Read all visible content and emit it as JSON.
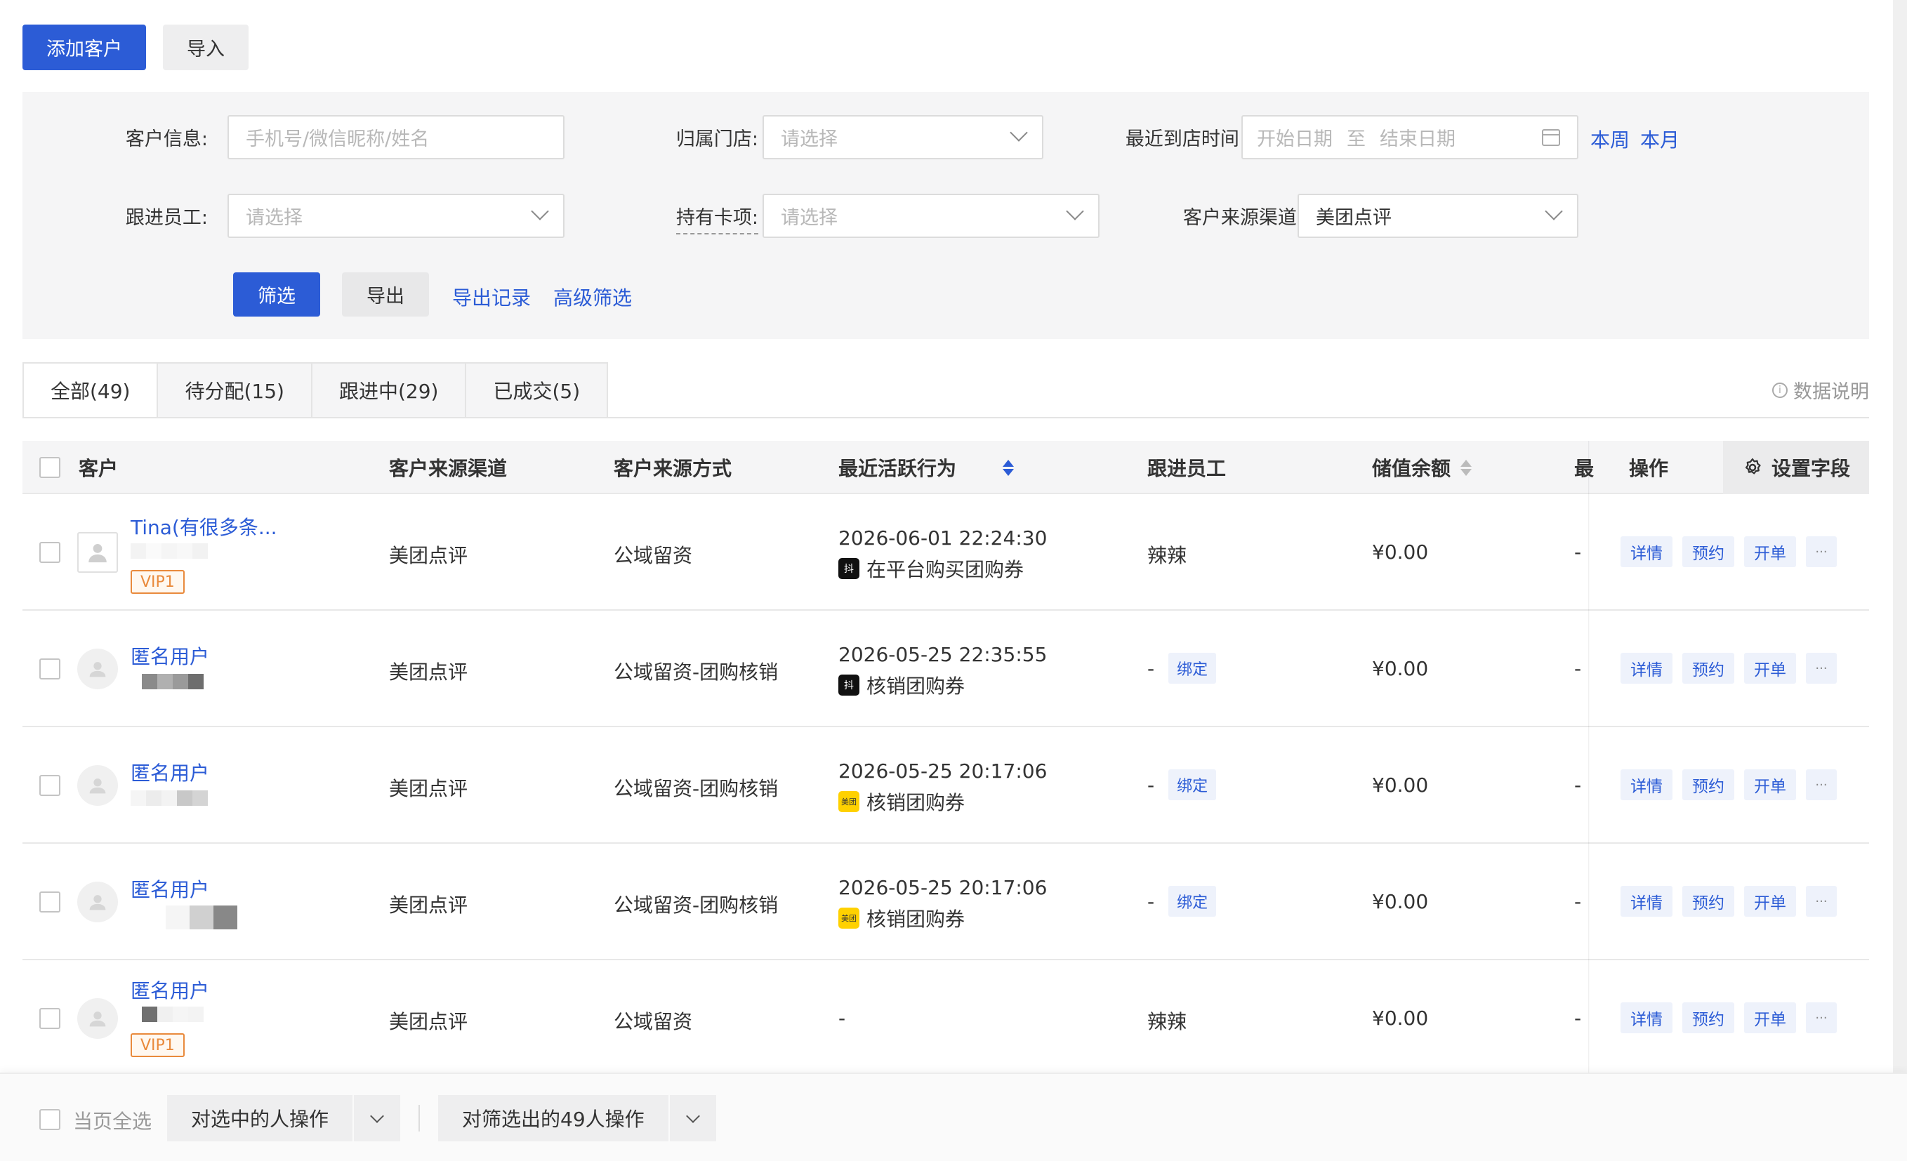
{
  "toolbar": {
    "add_customer": "添加客户",
    "import": "导入"
  },
  "filters": {
    "customer_info": {
      "label": "客户信息:",
      "placeholder": "手机号/微信昵称/姓名"
    },
    "store": {
      "label": "归属门店:",
      "placeholder": "请选择"
    },
    "last_visit": {
      "label": "最近到店时间:",
      "start": "开始日期",
      "sep": "至",
      "end": "结束日期",
      "this_week": "本周",
      "this_month": "本月"
    },
    "staff": {
      "label": "跟进员工:",
      "placeholder": "请选择"
    },
    "card": {
      "label": "持有卡项:",
      "placeholder": "请选择"
    },
    "channel": {
      "label": "客户来源渠道:",
      "value": "美团点评"
    },
    "filter_btn": "筛选",
    "export_btn": "导出",
    "export_records": "导出记录",
    "advanced_filter": "高级筛选"
  },
  "tabs": [
    {
      "label": "全部(49)"
    },
    {
      "label": "待分配(15)"
    },
    {
      "label": "跟进中(29)"
    },
    {
      "label": "已成交(5)"
    }
  ],
  "data_note": "数据说明",
  "table": {
    "headers": {
      "customer": "客户",
      "channel": "客户来源渠道",
      "method": "客户来源方式",
      "activity": "最近活跃行为",
      "staff": "跟进员工",
      "balance": "储值余额",
      "last": "最",
      "ops": "操作",
      "settings": "设置字段"
    },
    "op_labels": {
      "detail": "详情",
      "book": "预约",
      "order": "开单",
      "more": "···"
    },
    "bind_label": "绑定",
    "rows": [
      {
        "name": "Tina(有很多条...",
        "vip": "VIP1",
        "channel": "美团点评",
        "method": "公域留资",
        "time": "2026-06-01 22:24:30",
        "platform": "tiktok",
        "desc": "在平台购买团购券",
        "staff": "辣辣",
        "balance": "¥0.00",
        "last": "-"
      },
      {
        "name": "匿名用户",
        "vip": "",
        "channel": "美团点评",
        "method": "公域留资-团购核销",
        "time": "2026-05-25 22:35:55",
        "platform": "tiktok",
        "desc": "核销团购券",
        "staff": "-",
        "balance": "¥0.00",
        "last": "-"
      },
      {
        "name": "匿名用户",
        "vip": "",
        "channel": "美团点评",
        "method": "公域留资-团购核销",
        "time": "2026-05-25 20:17:06",
        "platform": "meituan",
        "desc": "核销团购券",
        "staff": "-",
        "balance": "¥0.00",
        "last": "-"
      },
      {
        "name": "匿名用户",
        "vip": "",
        "channel": "美团点评",
        "method": "公域留资-团购核销",
        "time": "2026-05-25 20:17:06",
        "platform": "meituan",
        "desc": "核销团购券",
        "staff": "-",
        "balance": "¥0.00",
        "last": "-"
      },
      {
        "name": "匿名用户",
        "vip": "VIP1",
        "channel": "美团点评",
        "method": "公域留资",
        "time": "",
        "platform": "",
        "desc": "-",
        "staff": "辣辣",
        "balance": "¥0.00",
        "last": "-"
      }
    ]
  },
  "bottom": {
    "select_page": "当页全选",
    "op_selected": "对选中的人操作",
    "op_filtered": "对筛选出的49人操作"
  },
  "colors": {
    "primary": "#2c5cd6",
    "vip": "#e98a3c",
    "meituan": "#ffd100"
  },
  "platform_icons": {
    "tiktok": "抖",
    "meituan": "美团"
  }
}
